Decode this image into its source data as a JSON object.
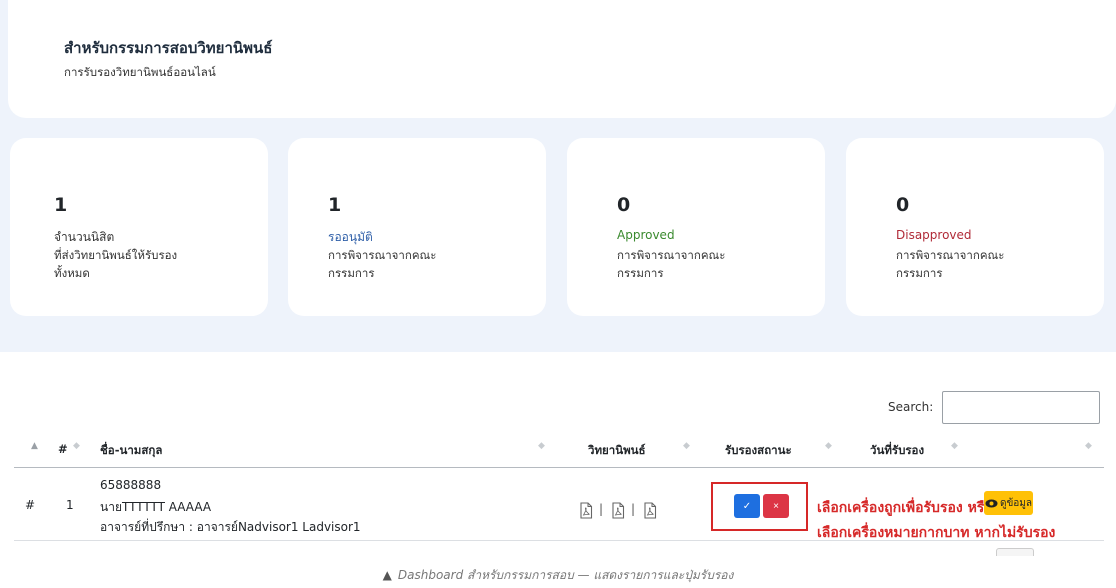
{
  "header": {
    "title": "สำหรับกรรมการสอบวิทยานิพนธ์",
    "subtitle": "การรับรองวิทยานิพนธ์ออนไลน์"
  },
  "stats": [
    {
      "value": "1",
      "label": "จำนวนนิสิต",
      "rest": "ที่ส่งวิทยานิพนธ์ให้รับรอง\nทั้งหมด",
      "label_color": "#333333"
    },
    {
      "value": "1",
      "label": "รออนุมัติ",
      "rest": "การพิจารณาจากคณะ\nกรรมการ",
      "label_color": "#2f5fa8"
    },
    {
      "value": "0",
      "label": "Approved",
      "rest": "การพิจารณาจากคณะ\nกรรมการ",
      "label_color": "#3a8a2e"
    },
    {
      "value": "0",
      "label": "Disapproved",
      "rest": "การพิจารณาจากคณะ\nกรรมการ",
      "label_color": "#b02a37"
    }
  ],
  "search": {
    "label": "Search:",
    "value": ""
  },
  "table": {
    "headers": [
      "#",
      "ชื่อ-นามสกุล",
      "วิทยานิพนธ์",
      "รับรองสถานะ",
      "วันที่รับรอง"
    ],
    "row": {
      "hash": "#",
      "num": "1",
      "student_id": "65888888",
      "name": "นายTTTTTT AAAAA",
      "advisor": "อาจารย์ที่ปรึกษา : อาจารย์Nadvisor1 Ladvisor1",
      "pdf_sep": "|",
      "approve_symbol": "✓",
      "reject_symbol": "×",
      "view_label": "ดูข้อมูล"
    }
  },
  "annotation": {
    "line1": "เลือกเครื่องถูกเพื่อรับรอง หรือ",
    "line2": "เลือกเครื่องหมายกากบาท หากไม่รับรอง"
  },
  "caption": "Dashboard สำหรับกรรมการสอบ — แสดงรายการและปุ่มรับรอง",
  "colors": {
    "approve": "#1e6fe0",
    "reject": "#dc3545",
    "view": "#ffc107",
    "annotation": "#d62828"
  }
}
